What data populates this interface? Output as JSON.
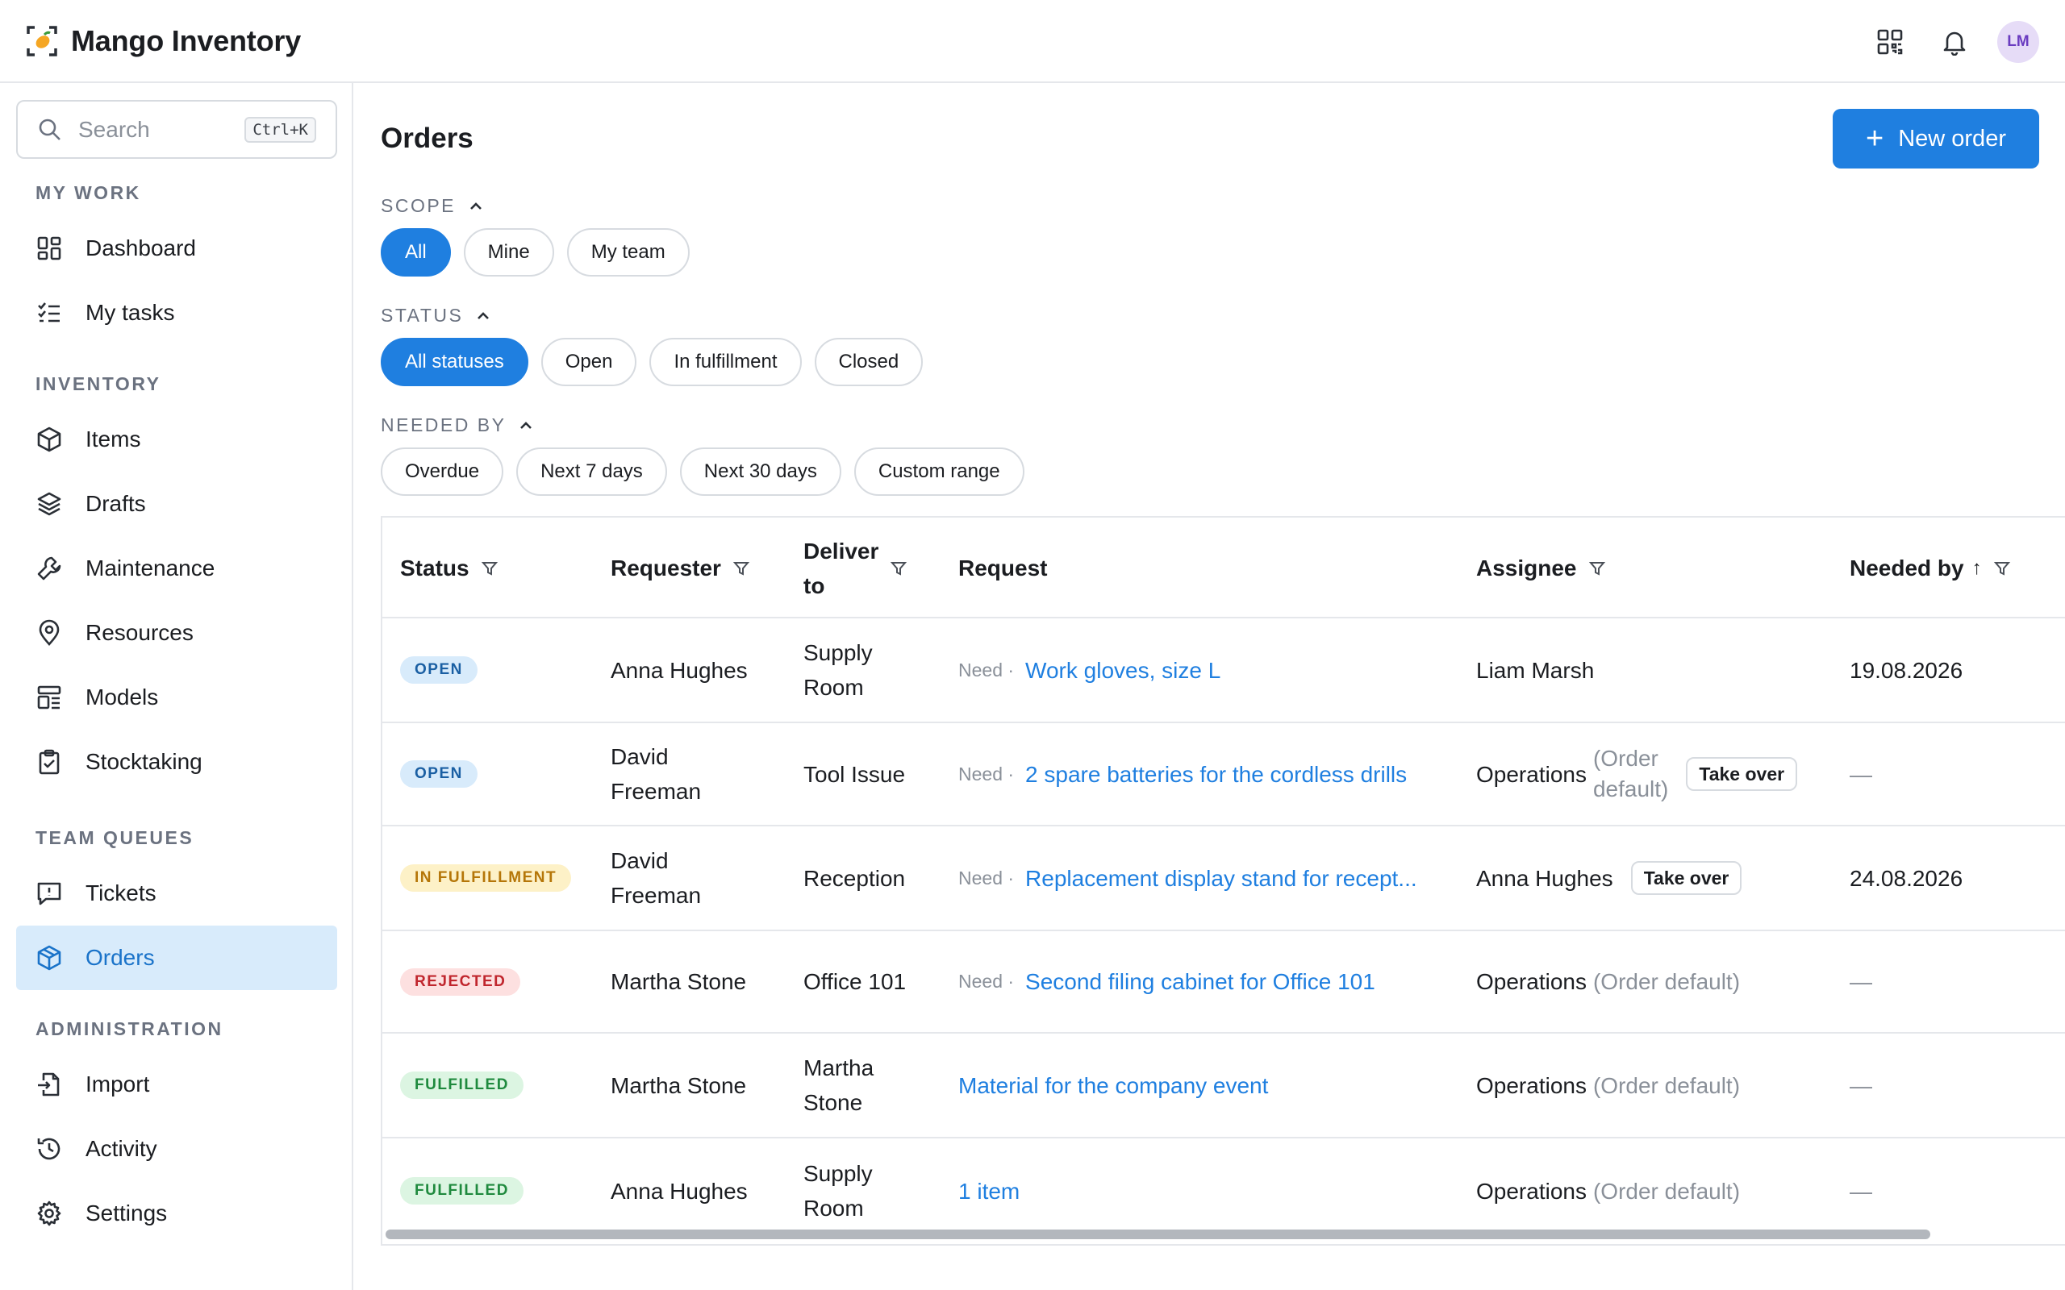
{
  "app": {
    "name": "Mango Inventory",
    "user_initials": "LM"
  },
  "topbar": {
    "icons": [
      "qr-code-icon",
      "bell-icon"
    ]
  },
  "sidebar": {
    "search": {
      "placeholder": "Search",
      "shortcut": "Ctrl+K"
    },
    "sections": [
      {
        "title": "MY WORK",
        "items": [
          {
            "label": "Dashboard",
            "icon": "dashboard-icon"
          },
          {
            "label": "My tasks",
            "icon": "tasks-icon"
          }
        ]
      },
      {
        "title": "INVENTORY",
        "items": [
          {
            "label": "Items",
            "icon": "cube-icon"
          },
          {
            "label": "Drafts",
            "icon": "layers-icon"
          },
          {
            "label": "Maintenance",
            "icon": "wrench-icon"
          },
          {
            "label": "Resources",
            "icon": "pin-icon"
          },
          {
            "label": "Models",
            "icon": "models-icon"
          },
          {
            "label": "Stocktaking",
            "icon": "clipboard-icon"
          }
        ]
      },
      {
        "title": "TEAM QUEUES",
        "items": [
          {
            "label": "Tickets",
            "icon": "ticket-icon"
          },
          {
            "label": "Orders",
            "icon": "order-box-icon",
            "active": true
          }
        ]
      },
      {
        "title": "ADMINISTRATION",
        "items": [
          {
            "label": "Import",
            "icon": "import-icon"
          },
          {
            "label": "Activity",
            "icon": "history-icon"
          },
          {
            "label": "Settings",
            "icon": "gear-icon"
          }
        ]
      }
    ]
  },
  "main": {
    "title": "Orders",
    "new_order_label": "New order",
    "filters": {
      "scope": {
        "label": "SCOPE",
        "options": [
          "All",
          "Mine",
          "My team"
        ],
        "selected": "All"
      },
      "status": {
        "label": "STATUS",
        "options": [
          "All statuses",
          "Open",
          "In fulfillment",
          "Closed"
        ],
        "selected": "All statuses"
      },
      "needed_by": {
        "label": "NEEDED BY",
        "options": [
          "Overdue",
          "Next 7 days",
          "Next 30 days",
          "Custom range"
        ],
        "selected": ""
      }
    },
    "table": {
      "columns": {
        "status": "Status",
        "requester": "Requester",
        "deliver_to_1": "Deliver",
        "deliver_to_2": "to",
        "request": "Request",
        "assignee": "Assignee",
        "needed_by": "Needed by",
        "sort_arrow": "↑"
      },
      "rows": [
        {
          "status": "OPEN",
          "status_kind": "open",
          "requester_1": "Anna Hughes",
          "requester_2": "",
          "deliver_1": "Supply",
          "deliver_2": "Room",
          "need": "Need ·",
          "request": "Work gloves, size L",
          "assignee": "Liam Marsh",
          "assignee_note_1": "",
          "assignee_note_2": "",
          "take_over": "",
          "needed_by": "19.08.2026"
        },
        {
          "status": "OPEN",
          "status_kind": "open",
          "requester_1": "David",
          "requester_2": "Freeman",
          "deliver_1": "Tool Issue",
          "deliver_2": "",
          "need": "Need ·",
          "request": "2 spare batteries for the cordless drills",
          "assignee": "Operations",
          "assignee_note_1": "(Order",
          "assignee_note_2": "default)",
          "take_over": "Take over",
          "needed_by": "—"
        },
        {
          "status": "IN FULFILLMENT",
          "status_kind": "fulfill",
          "requester_1": "David",
          "requester_2": "Freeman",
          "deliver_1": "Reception",
          "deliver_2": "",
          "need": "Need ·",
          "request": "Replacement display stand for recept...",
          "assignee": "Anna Hughes",
          "assignee_note_1": "",
          "assignee_note_2": "",
          "take_over": "Take over",
          "needed_by": "24.08.2026"
        },
        {
          "status": "REJECTED",
          "status_kind": "rejected",
          "requester_1": "Martha Stone",
          "requester_2": "",
          "deliver_1": "Office 101",
          "deliver_2": "",
          "need": "Need ·",
          "request": "Second filing cabinet for Office 101",
          "assignee": "Operations",
          "assignee_note_1": "(Order default)",
          "assignee_note_2": "",
          "take_over": "",
          "needed_by": "—"
        },
        {
          "status": "FULFILLED",
          "status_kind": "fulfilled",
          "requester_1": "Martha Stone",
          "requester_2": "",
          "deliver_1": "Martha",
          "deliver_2": "Stone",
          "need": "",
          "request": "Material for the company event",
          "assignee": "Operations",
          "assignee_note_1": "(Order default)",
          "assignee_note_2": "",
          "take_over": "",
          "needed_by": "—"
        },
        {
          "status": "FULFILLED",
          "status_kind": "fulfilled",
          "requester_1": "Anna Hughes",
          "requester_2": "",
          "deliver_1": "Supply",
          "deliver_2": "Room",
          "need": "",
          "request": "1 item",
          "assignee": "Operations",
          "assignee_note_1": "(Order default)",
          "assignee_note_2": "",
          "take_over": "",
          "needed_by": "—"
        }
      ]
    }
  },
  "colors": {
    "accent": "#1f7fe0",
    "active_nav_bg": "#d8ebfb"
  }
}
